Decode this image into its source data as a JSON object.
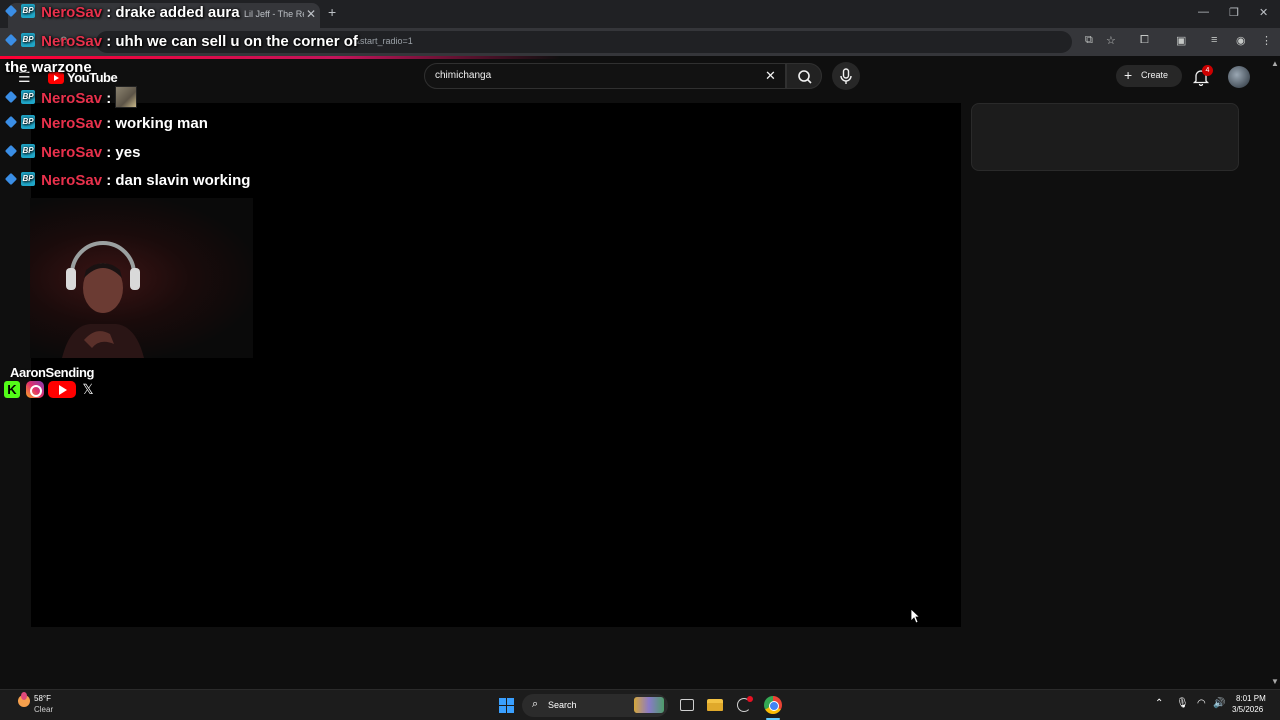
{
  "browser": {
    "tab_title": "Lil Jeff - The Rea",
    "url_fragment": "&start_radio=1",
    "new_tab": "+",
    "window_controls": [
      "—",
      "❐",
      "✕"
    ]
  },
  "youtube": {
    "logo_text": "YouTube",
    "search_value": "chimichanga",
    "create_label": "Create",
    "notification_count": "4"
  },
  "chat": {
    "username": "NeroSav",
    "separator": ":",
    "badge_label": "BP",
    "messages": [
      "drake added aura",
      "uhh we can sell u on the corner of",
      "",
      "working man",
      "yes",
      "dan slavin working"
    ],
    "continuation": "the warzone"
  },
  "overlay": {
    "streamer_name": "AaronSending",
    "kick_letter": "K",
    "x_letter": "𝕏"
  },
  "taskbar": {
    "weather_temp": "58°F",
    "weather_desc": "Clear",
    "search_label": "Search",
    "clock_time": "8:01 PM",
    "clock_date": "3/5/2026"
  },
  "colors": {
    "chat_username": "#e8314c",
    "youtube_red": "#ff0000",
    "page_bg": "#0f0f0f"
  }
}
